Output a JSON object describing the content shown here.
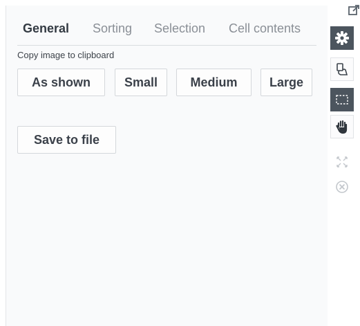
{
  "tabs": [
    {
      "label": "General",
      "active": true
    },
    {
      "label": "Sorting",
      "active": false
    },
    {
      "label": "Selection",
      "active": false
    },
    {
      "label": "Cell contents",
      "active": false
    }
  ],
  "copy_section": {
    "label": "Copy image to clipboard",
    "buttons": [
      "As shown",
      "Small",
      "Medium",
      "Large"
    ]
  },
  "save_button": "Save to file",
  "toolbar": {
    "icons": [
      "popout-icon",
      "gear-icon",
      "lasso-select-icon",
      "rectangle-select-icon",
      "hand-pan-icon",
      "expand-icon",
      "close-icon"
    ],
    "active_icon": "gear-icon",
    "dark_color": "#4c555e"
  }
}
